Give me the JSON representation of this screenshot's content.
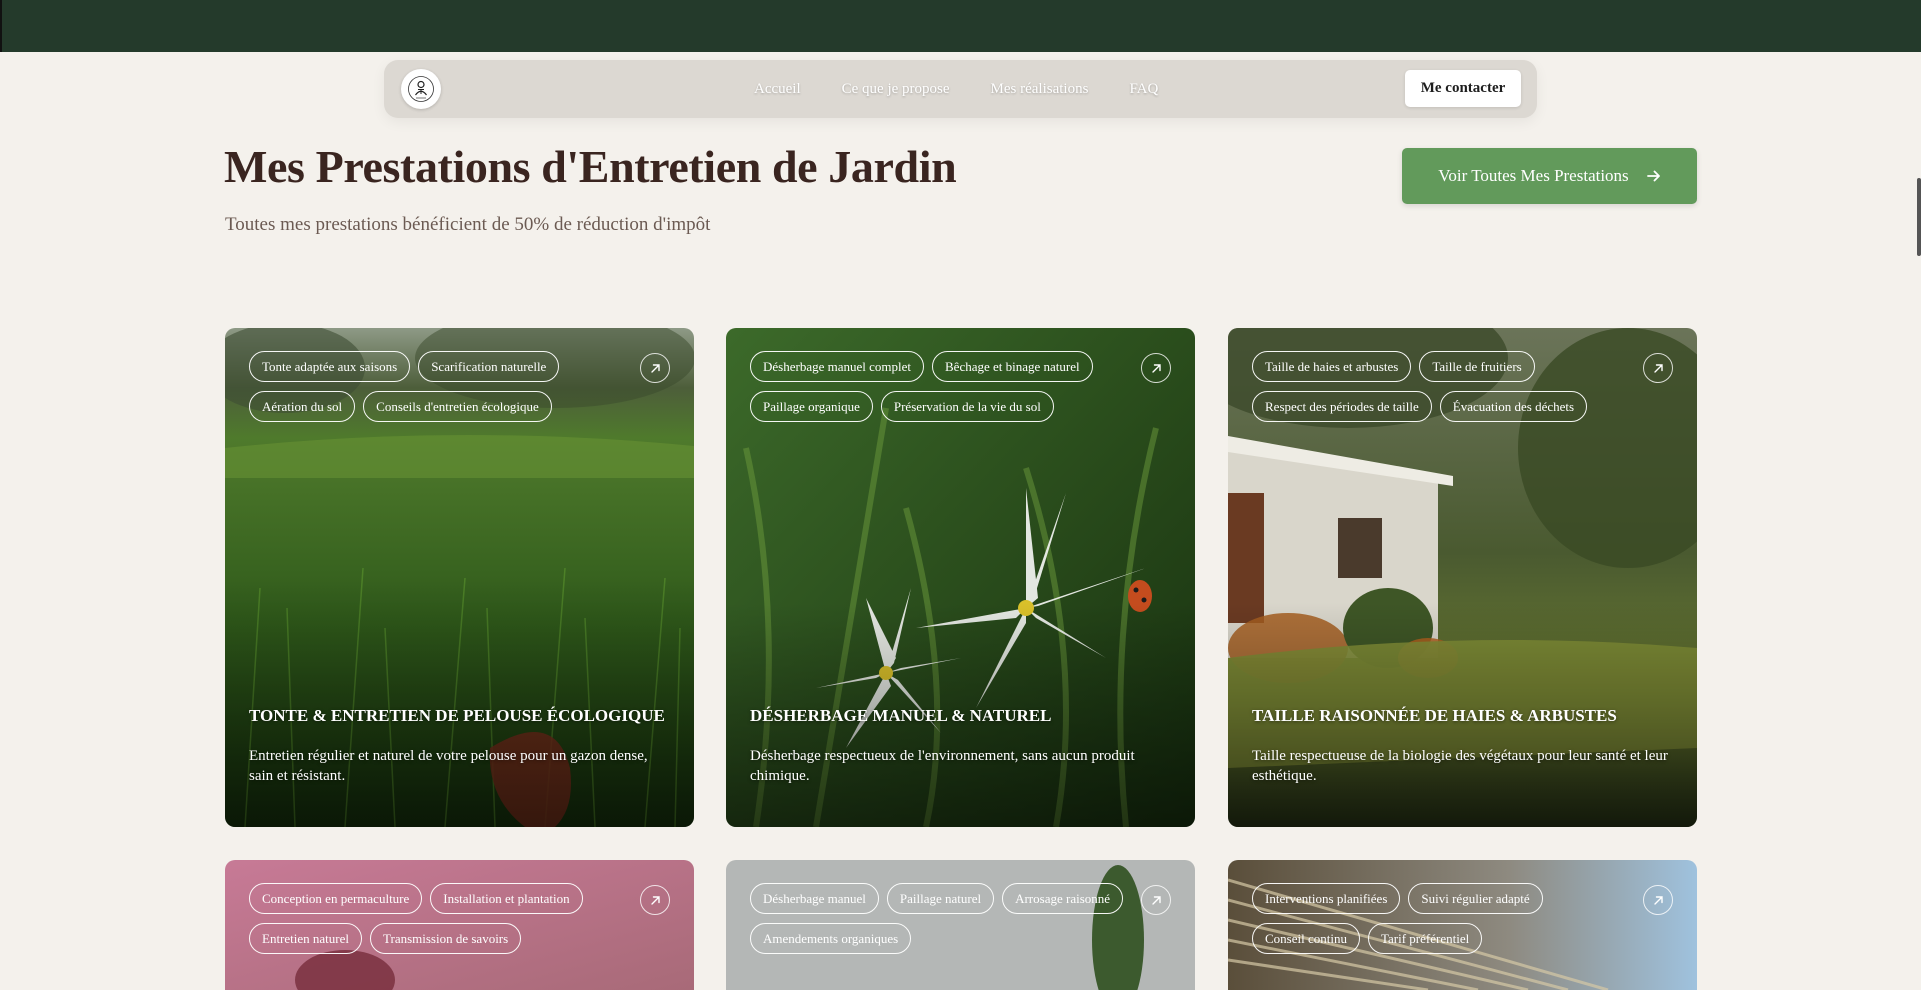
{
  "nav": {
    "links": [
      "Accueil",
      "Ce que je propose",
      "Mes réalisations",
      "FAQ"
    ],
    "contact_label": "Me contacter"
  },
  "header": {
    "title": "Mes Prestations d'Entretien de Jardin",
    "subtitle": "Toutes mes prestations bénéficient de 50% de réduction d'impôt",
    "all_services_label": "Voir Toutes Mes Prestations"
  },
  "cards": [
    {
      "tags": [
        "Tonte adaptée aux saisons",
        "Scarification naturelle",
        "Aération du sol",
        "Conseils d'entretien écologique"
      ],
      "title": "TONTE & ENTRETIEN DE PELOUSE ÉCOLOGIQUE",
      "description": "Entretien régulier et naturel de votre pelouse pour un gazon dense, sain et résistant."
    },
    {
      "tags": [
        "Désherbage manuel complet",
        "Bêchage et binage naturel",
        "Paillage organique",
        "Préservation de la vie du sol"
      ],
      "title": "DÉSHERBAGE MANUEL & NATUREL",
      "description": "Désherbage respectueux de l'environnement, sans aucun produit chimique."
    },
    {
      "tags": [
        "Taille de haies et arbustes",
        "Taille de fruitiers",
        "Respect des périodes de taille",
        "Évacuation des déchets"
      ],
      "title": "TAILLE RAISONNÉE DE HAIES & ARBUSTES",
      "description": "Taille respectueuse de la biologie des végétaux pour leur santé et leur esthétique."
    },
    {
      "tags": [
        "Conception en permaculture",
        "Installation et plantation",
        "Entretien naturel",
        "Transmission de savoirs"
      ]
    },
    {
      "tags": [
        "Désherbage manuel",
        "Paillage naturel",
        "Arrosage raisonné",
        "Amendements organiques"
      ]
    },
    {
      "tags": [
        "Interventions planifiées",
        "Suivi régulier adapté",
        "Conseil continu",
        "Tarif préférentiel"
      ]
    }
  ],
  "icons": {
    "logo": "gardener-logo",
    "all_services_arrow": "arrow-right-icon",
    "card_link": "arrow-up-right-icon"
  },
  "colors": {
    "topbar": "#243a2b",
    "accent_green": "#629a5b",
    "title": "#3a2520",
    "background": "#f4f1ec"
  }
}
